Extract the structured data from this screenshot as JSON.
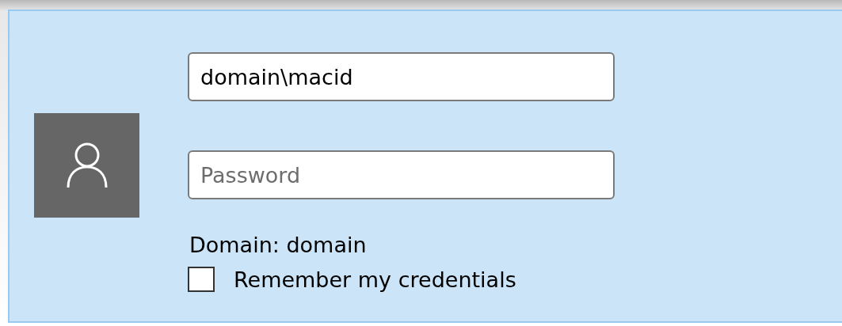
{
  "credential_tile": {
    "username": {
      "value": "domain\\macid"
    },
    "password": {
      "placeholder": "Password"
    },
    "domain_label": "Domain: domain",
    "remember": {
      "label": "Remember my credentials",
      "checked": false
    }
  }
}
